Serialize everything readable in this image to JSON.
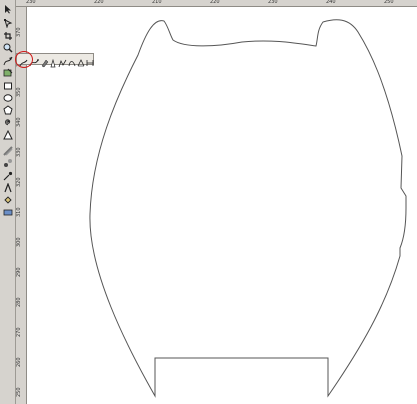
{
  "toolbox": {
    "tools": [
      {
        "name": "pick-tool-icon"
      },
      {
        "name": "shape-tool-icon"
      },
      {
        "name": "crop-tool-icon"
      },
      {
        "name": "zoom-tool-icon"
      },
      {
        "name": "curve-tool-icon"
      },
      {
        "name": "smart-fill-tool-icon"
      },
      {
        "name": "rectangle-tool-icon"
      },
      {
        "name": "ellipse-tool-icon"
      },
      {
        "name": "polygon-tool-icon"
      },
      {
        "name": "spiral-tool-icon"
      },
      {
        "name": "basic-shapes-tool-icon"
      },
      {
        "name": "text-tool-icon"
      },
      {
        "name": "interactive-blend-tool-icon"
      },
      {
        "name": "eyedropper-tool-icon"
      },
      {
        "name": "outline-tool-icon"
      },
      {
        "name": "fill-tool-icon"
      },
      {
        "name": "interactive-fill-tool-icon"
      }
    ]
  },
  "curve_flyout": {
    "tools": [
      {
        "name": "freehand-tool-icon"
      },
      {
        "name": "bezier-tool-icon"
      },
      {
        "name": "artistic-media-tool-icon"
      },
      {
        "name": "pen-tool-icon"
      },
      {
        "name": "polyline-tool-icon"
      },
      {
        "name": "three-point-curve-tool-icon"
      },
      {
        "name": "interactive-connector-tool-icon"
      },
      {
        "name": "dimension-tool-icon"
      }
    ],
    "highlight_color": "#d11919"
  },
  "ruler_top": {
    "labels": [
      "230",
      "220",
      "210",
      "220",
      "230",
      "240",
      "250"
    ]
  },
  "ruler_left": {
    "labels": [
      "370",
      "360",
      "350",
      "340",
      "330",
      "320",
      "310",
      "300",
      "290",
      "280",
      "270",
      "260",
      "250"
    ]
  },
  "canvas": {
    "outline_color": "#555555"
  }
}
